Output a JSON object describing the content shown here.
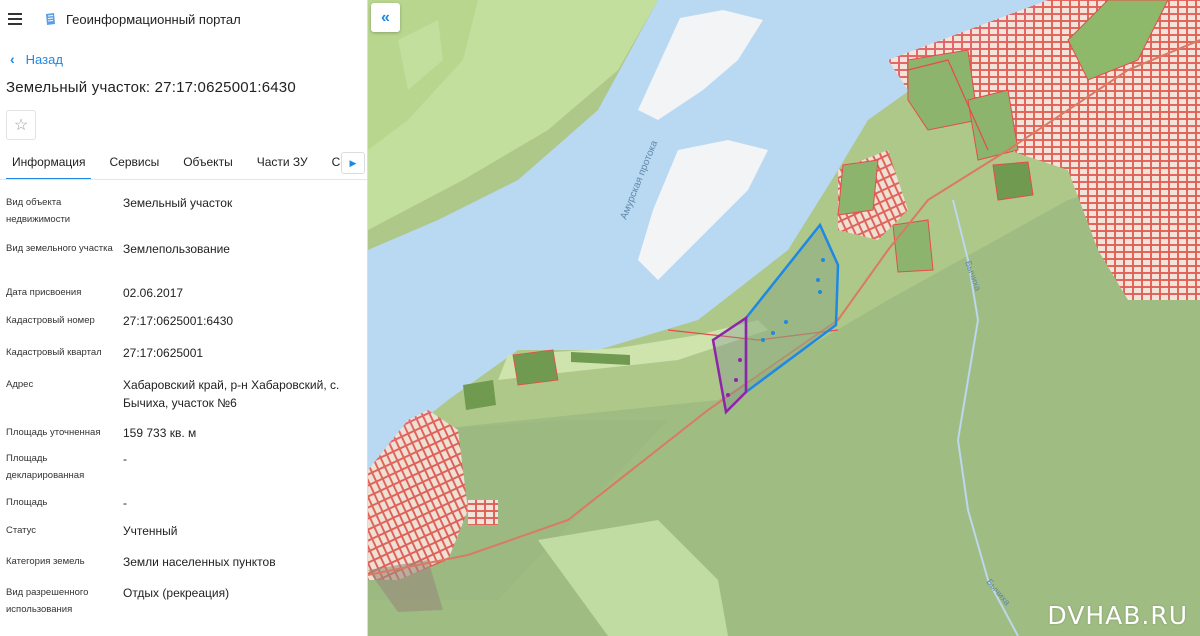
{
  "app": {
    "title": "Геоинформационный портал"
  },
  "nav": {
    "back_label": "Назад"
  },
  "page": {
    "title": "Земельный участок: 27:17:0625001:6430"
  },
  "tabs": [
    {
      "label": "Информация",
      "active": true
    },
    {
      "label": "Сервисы"
    },
    {
      "label": "Объекты"
    },
    {
      "label": "Части ЗУ"
    },
    {
      "label": "Сос"
    }
  ],
  "properties": [
    {
      "label": "Вид объекта недвижимости",
      "value": "Земельный участок"
    },
    {
      "label": "Вид земельного участка",
      "value": "Землепользование"
    },
    {
      "label": "Дата присвоения",
      "value": "02.06.2017"
    },
    {
      "label": "Кадастровый номер",
      "value": "27:17:0625001:6430"
    },
    {
      "label": "Кадастровый квартал",
      "value": "27:17:0625001"
    },
    {
      "label": "Адрес",
      "value": "Хабаровский край, р-н Хабаровский, с. Бычиха, участок №6"
    },
    {
      "label": "Площадь уточненная",
      "value": "159 733 кв. м"
    },
    {
      "label": "Площадь декларированная",
      "value": "-"
    },
    {
      "label": "Площадь",
      "value": "-"
    },
    {
      "label": "Статус",
      "value": "Учтенный"
    },
    {
      "label": "Категория земель",
      "value": "Земли населенных пунктов"
    },
    {
      "label": "Вид разрешенного использования",
      "value": "Отдых (рекреация)"
    }
  ],
  "map": {
    "labels": {
      "channel": "Амурская протока",
      "river": "Бычиха"
    },
    "watermark": "DVHAB.RU",
    "colors": {
      "water": "#b9d8f2",
      "land": "#b7cf92",
      "parcel_outline": "#e84a4a",
      "selected": "#1e88e5",
      "highlight": "#8e24aa"
    }
  },
  "icons": {
    "menu": "hamburger-icon",
    "logo": "portal-logo-icon",
    "back": "chevron-left-icon",
    "favorite": "star-icon",
    "tabs_next": "chevron-right-icon",
    "collapse": "double-chevron-left-icon"
  }
}
